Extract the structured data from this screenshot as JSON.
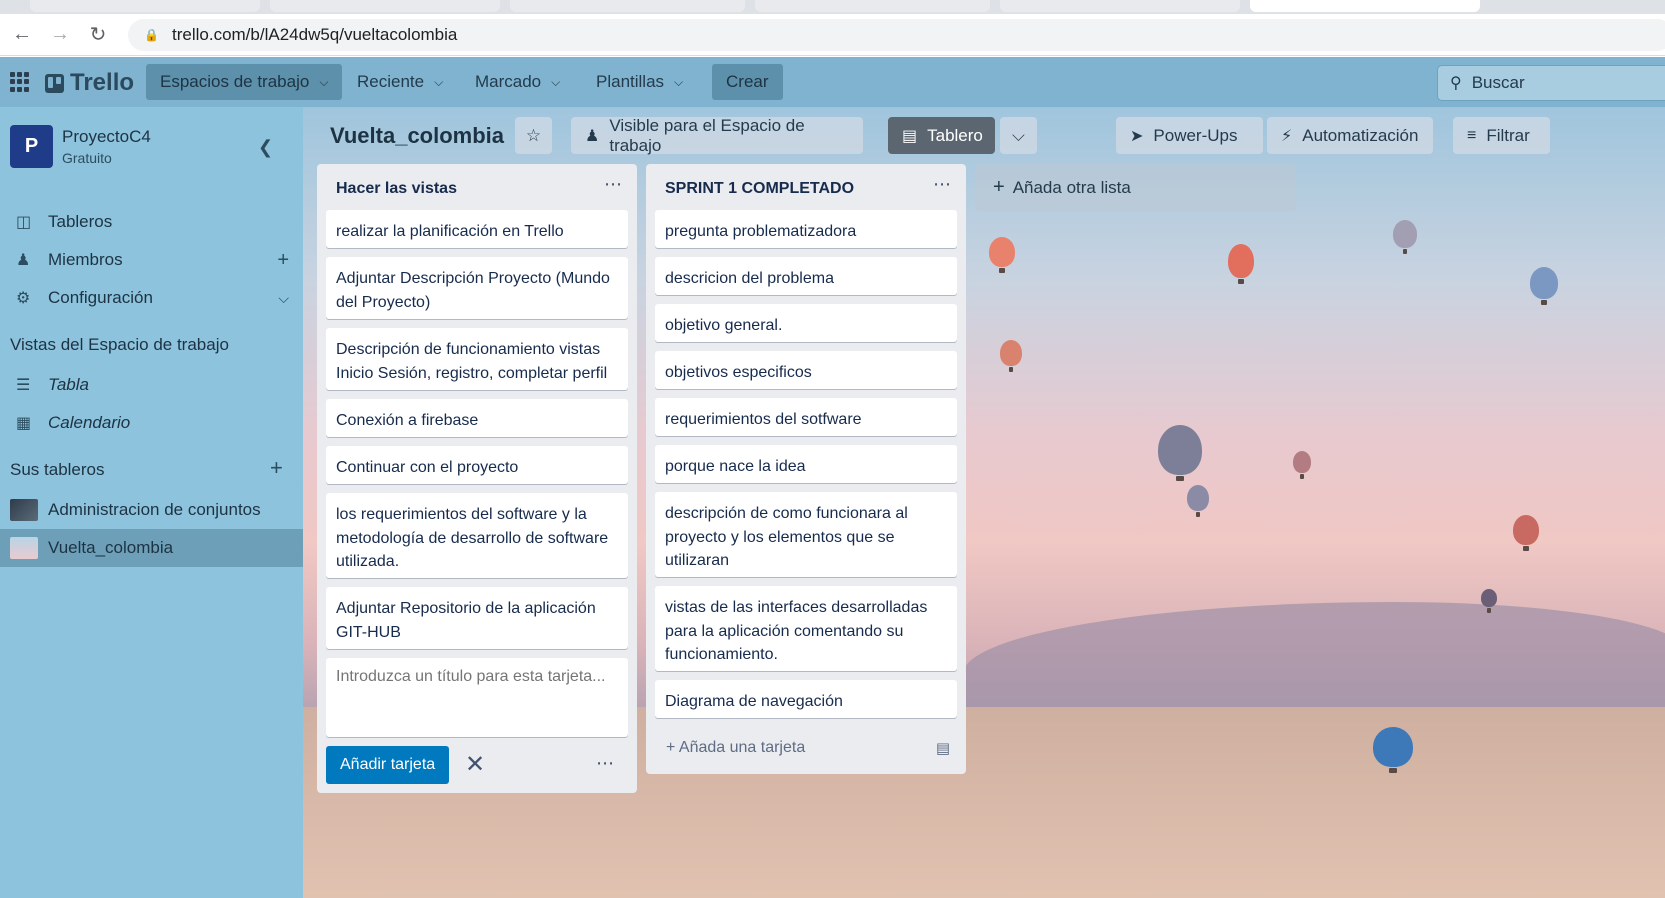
{
  "browser": {
    "url": "trello.com/b/lA24dw5q/vueltacolombia"
  },
  "header": {
    "logo": "Trello",
    "nav": [
      {
        "label": "Espacios de trabajo"
      },
      {
        "label": "Reciente"
      },
      {
        "label": "Marcado"
      },
      {
        "label": "Plantillas"
      }
    ],
    "create": "Crear",
    "search_placeholder": "Buscar"
  },
  "sidebar": {
    "workspace_initial": "P",
    "workspace_name": "ProyectoC4",
    "workspace_plan": "Gratuito",
    "items": [
      {
        "label": "Tableros",
        "icon": "board-icon"
      },
      {
        "label": "Miembros",
        "icon": "person-icon"
      },
      {
        "label": "Configuración",
        "icon": "gear-icon"
      }
    ],
    "views_heading": "Vistas del Espacio de trabajo",
    "views": [
      {
        "label": "Tabla",
        "icon": "table-icon"
      },
      {
        "label": "Calendario",
        "icon": "calendar-icon"
      }
    ],
    "boards_heading": "Sus tableros",
    "boards": [
      {
        "label": "Administracion de conjuntos"
      },
      {
        "label": "Vuelta_colombia"
      }
    ]
  },
  "board": {
    "title": "Vuelta_colombia",
    "visibility": "Visible para el Espacio de trabajo",
    "view": "Tablero",
    "powerups": "Power-Ups",
    "automation": "Automatización",
    "filter": "Filtrar",
    "add_list": "Añada otra lista",
    "colors": {
      "accent": "#0079bf",
      "list_bg": "#ebecf0"
    }
  },
  "lists": [
    {
      "title": "Hacer las vistas",
      "cards": [
        "realizar la planificación en Trello",
        "Adjuntar Descripción Proyecto (Mundo del Proyecto)",
        "Descripción de funcionamiento vistas Inicio Sesión, registro, completar perfil",
        "Conexión a firebase",
        "Continuar con el proyecto",
        "los requerimientos del software y la metodología de desarrollo de software utilizada.",
        "Adjuntar Repositorio de la aplicación GIT-HUB"
      ],
      "composer_placeholder": "Introduzca un título para esta tarjeta...",
      "add_button": "Añadir tarjeta"
    },
    {
      "title": "SPRINT 1 COMPLETADO",
      "cards": [
        "pregunta problematizadora",
        "descricion del problema",
        "objetivo general.",
        "objetivos especificos",
        "requerimientos del sotfware",
        "porque nace la idea",
        "descripción de como funcionara al proyecto y los elementos que se utilizaran",
        "vistas de las interfaces desarrolladas para la aplicación comentando su funcionamiento.",
        "Diagrama de navegación"
      ],
      "add_card": "Añada una tarjeta"
    }
  ]
}
